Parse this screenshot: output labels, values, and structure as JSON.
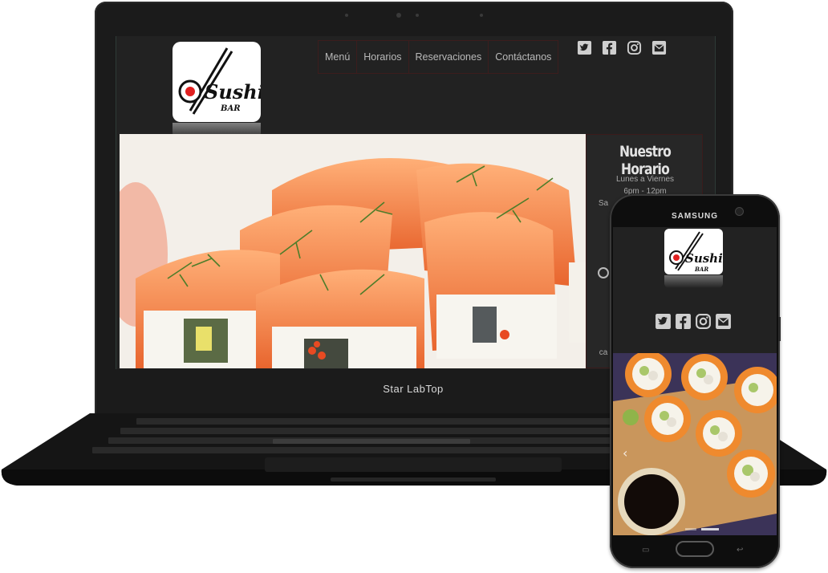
{
  "site": {
    "logo": {
      "text": "Sushi",
      "subtext": "BAR"
    },
    "nav": [
      {
        "label": "Menú"
      },
      {
        "label": "Horarios"
      },
      {
        "label": "Reservaciones"
      },
      {
        "label": "Contáctanos"
      }
    ],
    "social_icons": [
      "twitter-icon",
      "facebook-icon",
      "instagram-icon",
      "envelope-icon"
    ],
    "hours": {
      "title": "Nuestro Horario",
      "days": "Lunes a Viernes",
      "time": "6pm - 12pm",
      "partial_line": "Sa"
    },
    "partial_contact": "ca"
  },
  "laptop": {
    "brand": "Star LabTop"
  },
  "phone": {
    "brand": "SAMSUNG"
  },
  "colors": {
    "page_bg": "#222222",
    "nav_border": "#3c1d1d",
    "salmon": "#f08a52",
    "rice": "#f4f1ea"
  }
}
